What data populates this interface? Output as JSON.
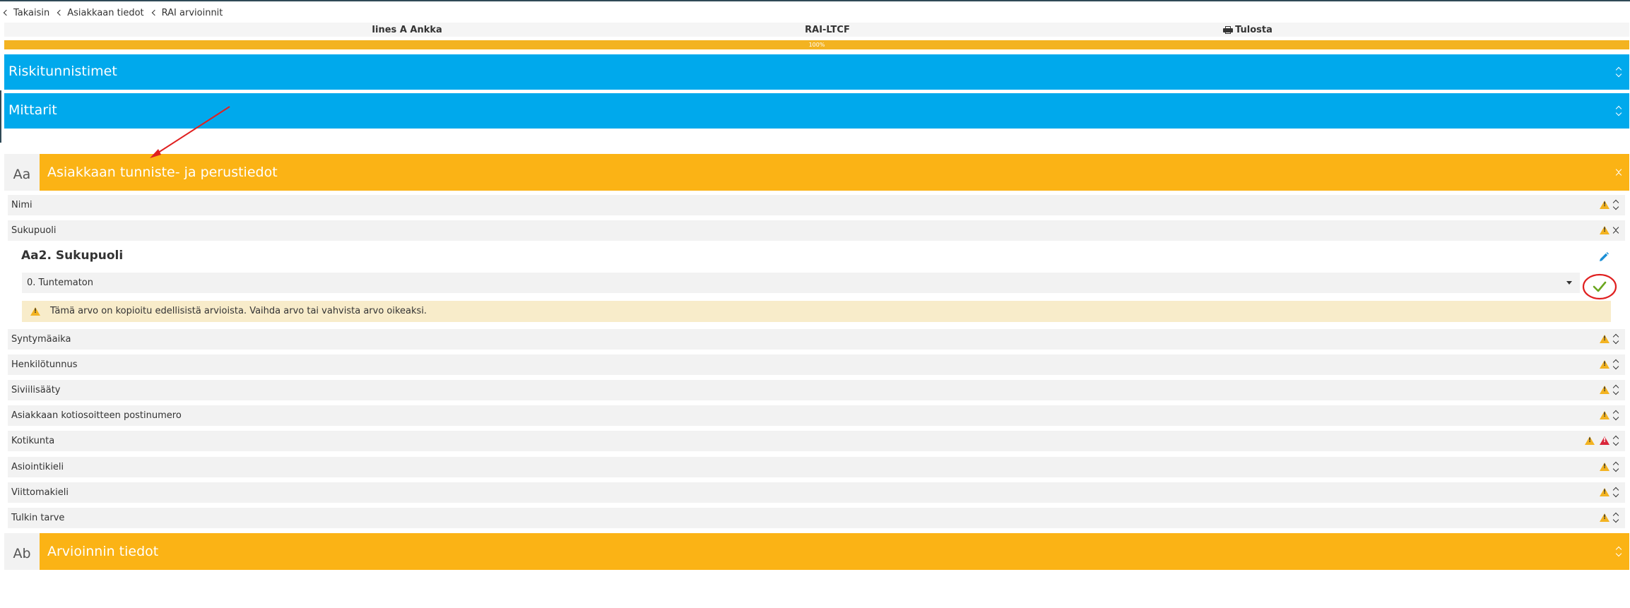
{
  "breadcrumb": {
    "items": [
      "Takaisin",
      "Asiakkaan tiedot",
      "RAI arvioinnit"
    ]
  },
  "header": {
    "client_name": "Iines A Ankka",
    "form_name": "RAI-LTCF",
    "print_label": "Tulosta"
  },
  "progress": {
    "value": 100,
    "label": "100%"
  },
  "colors": {
    "blue_section": "#00a9ec",
    "gold_section": "#fbb315",
    "warning": "#f3b321",
    "error": "#d9263a",
    "confirm": "#6aa61e",
    "annotation": "#e02020"
  },
  "sections": {
    "riskitunnistimet": {
      "title": "Riskitunnistimet"
    },
    "mittarit": {
      "title": "Mittarit"
    },
    "aa": {
      "code": "Aa",
      "title": "Asiakkaan tunniste- ja perustiedot"
    },
    "ab": {
      "code": "Ab",
      "title": "Arvioinnin tiedot"
    }
  },
  "questions": {
    "nimi": {
      "label": "Nimi"
    },
    "sukupuoli": {
      "label": "Sukupuoli"
    },
    "syntymaaika": {
      "label": "Syntymäaika"
    },
    "henkilotunnus": {
      "label": "Henkilötunnus"
    },
    "siviilisaaty": {
      "label": "Siviilisääty"
    },
    "postinumero": {
      "label": "Asiakkaan kotiosoitteen postinumero"
    },
    "kotikunta": {
      "label": "Kotikunta"
    },
    "asiointikieli": {
      "label": "Asiointikieli"
    },
    "viittomakieli": {
      "label": "Viittomakieli"
    },
    "tulkin_tarve": {
      "label": "Tulkin tarve"
    }
  },
  "detail": {
    "title": "Aa2. Sukupuoli",
    "selected_value": "0. Tuntematon",
    "notice": "Tämä arvo on kopioitu edellisistä arvioista. Vaihda arvo tai vahvista arvo oikeaksi."
  },
  "icons": {
    "print": "printer-icon",
    "warning": "warning-triangle-icon",
    "error": "error-triangle-icon",
    "edit": "pencil-icon",
    "confirm": "checkmark-icon",
    "expand": "chevron-updown-icon",
    "collapse": "chevron-collapse-icon"
  }
}
